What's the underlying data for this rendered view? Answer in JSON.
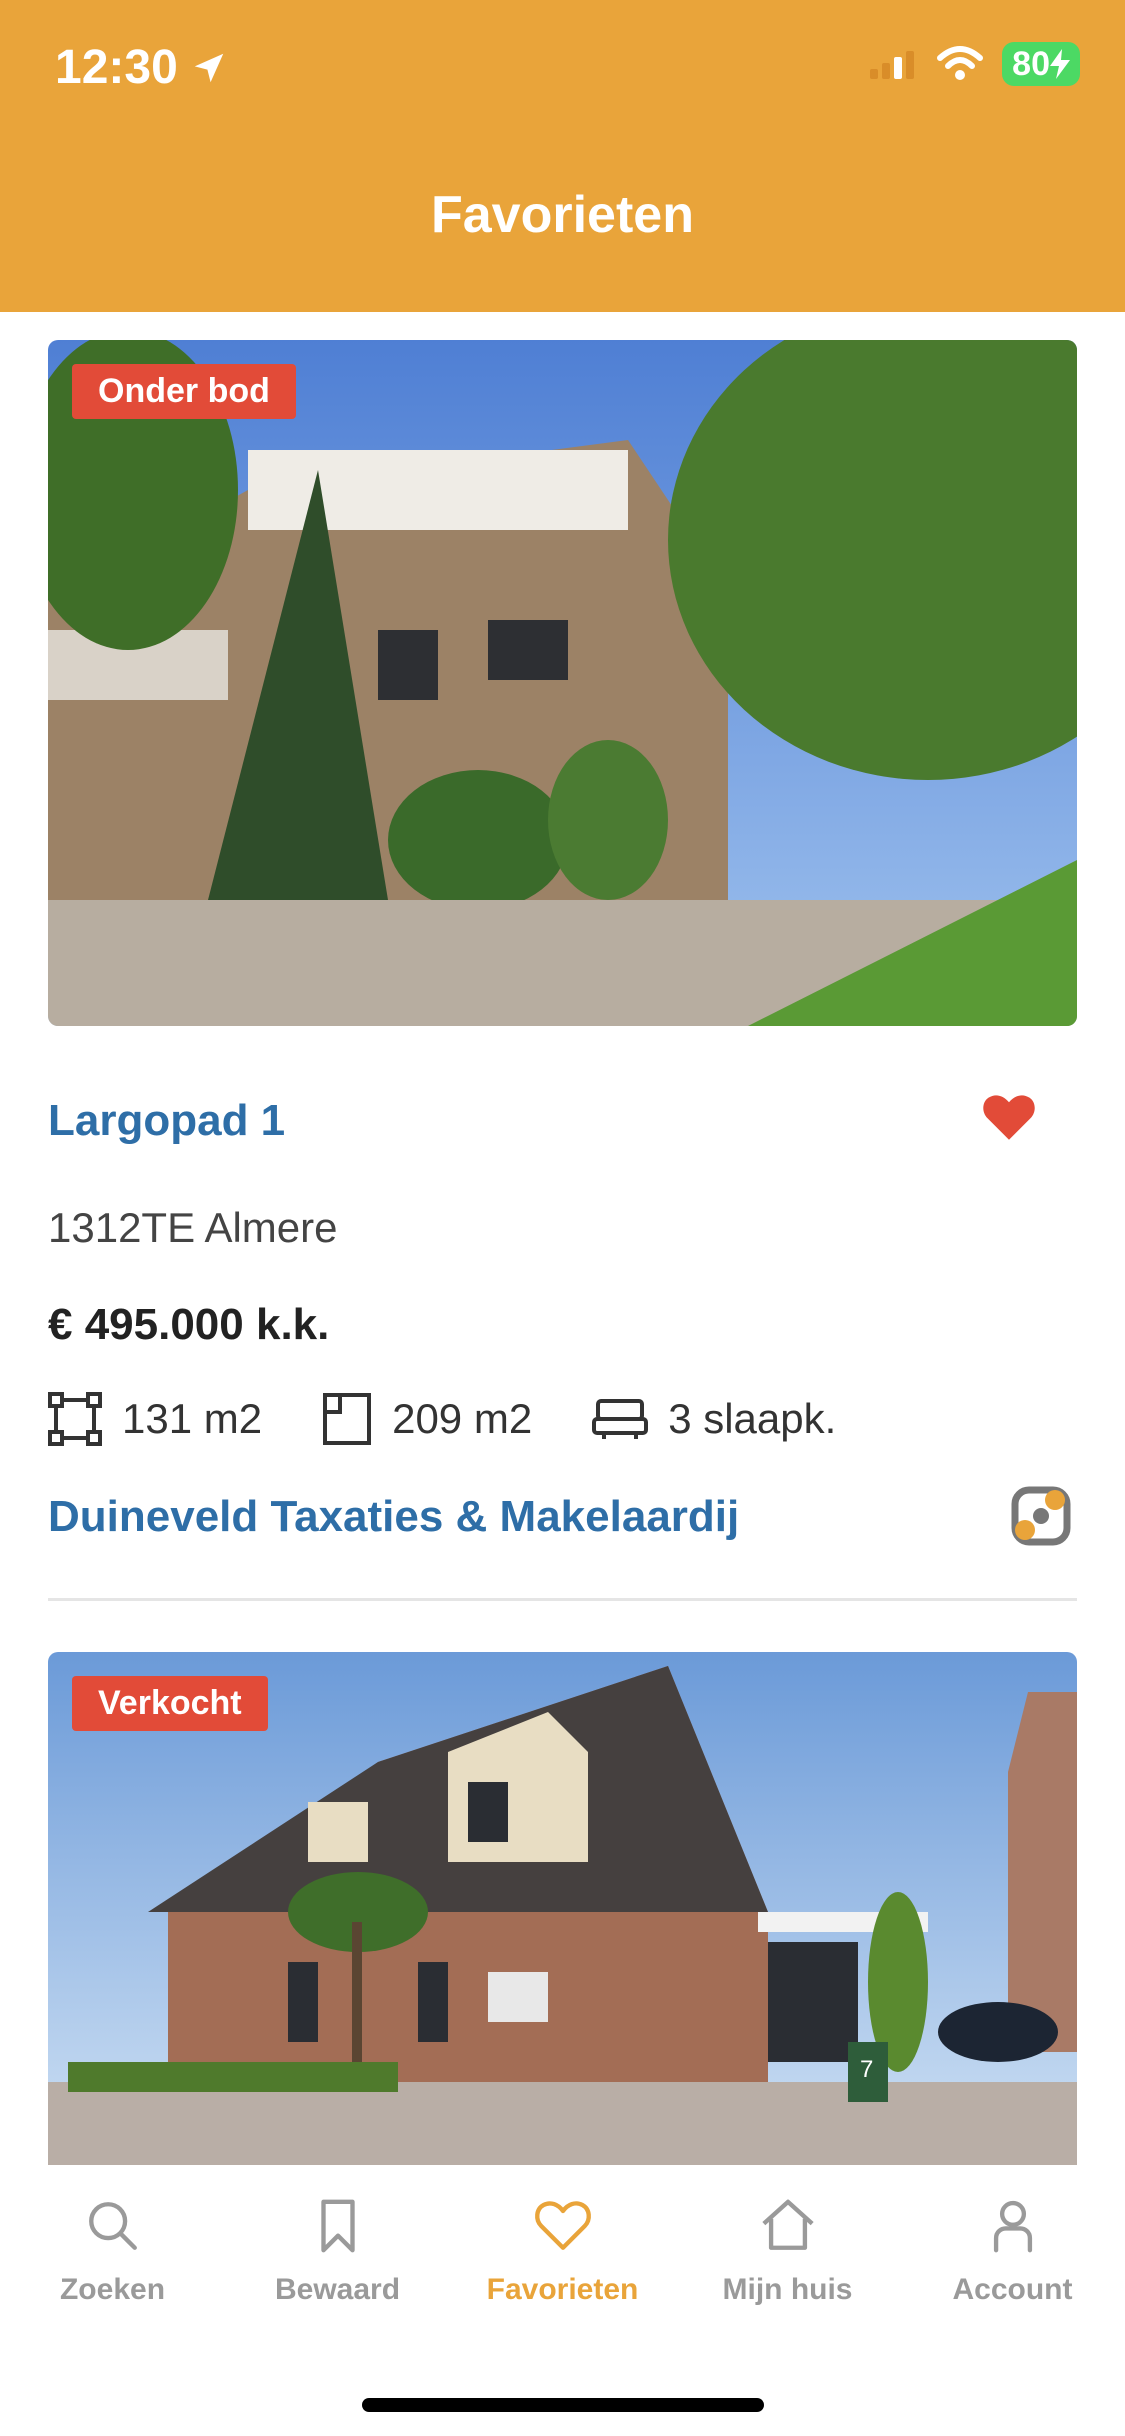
{
  "status_bar": {
    "time": "12:30",
    "battery": "80"
  },
  "header": {
    "title": "Favorieten"
  },
  "listings": [
    {
      "badge": "Onder bod",
      "title": "Largopad 1",
      "city": "1312TE Almere",
      "price": "€ 495.000 k.k.",
      "features": {
        "living_area": "131 m2",
        "plot_area": "209 m2",
        "bedrooms": "3 slaapk."
      },
      "agent": "Duineveld Taxaties & Makelaardij"
    },
    {
      "badge": "Verkocht",
      "mailbox_number": "7"
    }
  ],
  "tabbar": {
    "items": [
      {
        "label": "Zoeken",
        "icon": "search-icon"
      },
      {
        "label": "Bewaard",
        "icon": "bookmark-icon"
      },
      {
        "label": "Favorieten",
        "icon": "heart-icon"
      },
      {
        "label": "Mijn huis",
        "icon": "house-icon"
      },
      {
        "label": "Account",
        "icon": "person-icon"
      }
    ],
    "active": "Favorieten"
  },
  "colors": {
    "brand": "#e9a43a",
    "link": "#2e6ea7",
    "badge": "#e24b38",
    "heart": "#e24b38",
    "battery": "#4cd964"
  }
}
